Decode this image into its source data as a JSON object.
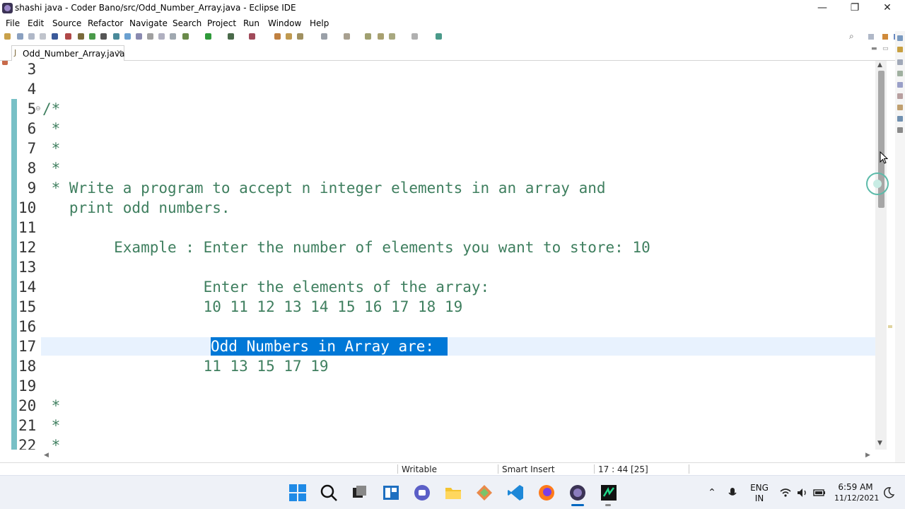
{
  "window": {
    "title": "shashi java - Coder Bano/src/Odd_Number_Array.java - Eclipse IDE",
    "minimize": "—",
    "maximize": "❐",
    "close": "✕"
  },
  "menu": {
    "items": [
      "File",
      "Edit",
      "Source",
      "Refactor",
      "Navigate",
      "Search",
      "Project",
      "Run",
      "Window",
      "Help"
    ]
  },
  "toolbar": {
    "search_icon": "⌕"
  },
  "editor": {
    "tab": {
      "label": "Odd_Number_Array.java",
      "close": "✕",
      "icon": "java-file-icon"
    },
    "lines": [
      {
        "num": " 3",
        "text": ""
      },
      {
        "num": " 4",
        "text": ""
      },
      {
        "num": " 5",
        "text": "/*"
      },
      {
        "num": " 6",
        "text": " *"
      },
      {
        "num": " 7",
        "text": " *"
      },
      {
        "num": " 8",
        "text": " *"
      },
      {
        "num": " 9",
        "text": " * Write a program to accept n integer elements in an array and"
      },
      {
        "num": "10",
        "text": "   print odd numbers."
      },
      {
        "num": "11",
        "text": ""
      },
      {
        "num": "12",
        "text": "        Example : Enter the number of elements you want to store: 10"
      },
      {
        "num": "13",
        "text": ""
      },
      {
        "num": "14",
        "text": "                  Enter the elements of the array:"
      },
      {
        "num": "15",
        "text": "                  10 11 12 13 14 15 16 17 18 19"
      },
      {
        "num": "16",
        "text": ""
      },
      {
        "num": "17",
        "text": ""
      },
      {
        "num": "18",
        "text": "                  11 13 15 17 19"
      },
      {
        "num": "19",
        "text": ""
      },
      {
        "num": "20",
        "text": " *"
      },
      {
        "num": "21",
        "text": " *"
      },
      {
        "num": "22",
        "text": " *"
      }
    ],
    "selected_text": "Odd Numbers in Array are:",
    "fold_marker": "⊖"
  },
  "status": {
    "writable": "Writable",
    "insert_mode": "Smart Insert",
    "position": "17 : 44 [25]"
  },
  "taskbar": {
    "tray": {
      "lang_top": "ENG",
      "lang_bottom": "IN",
      "time": "6:59 AM",
      "date": "11/12/2021"
    }
  },
  "colors": {
    "comment_green": "#3f7f5f",
    "selection_blue": "#0078d7",
    "current_line": "#e8f2fe",
    "change_bar": "#78c0c6"
  }
}
